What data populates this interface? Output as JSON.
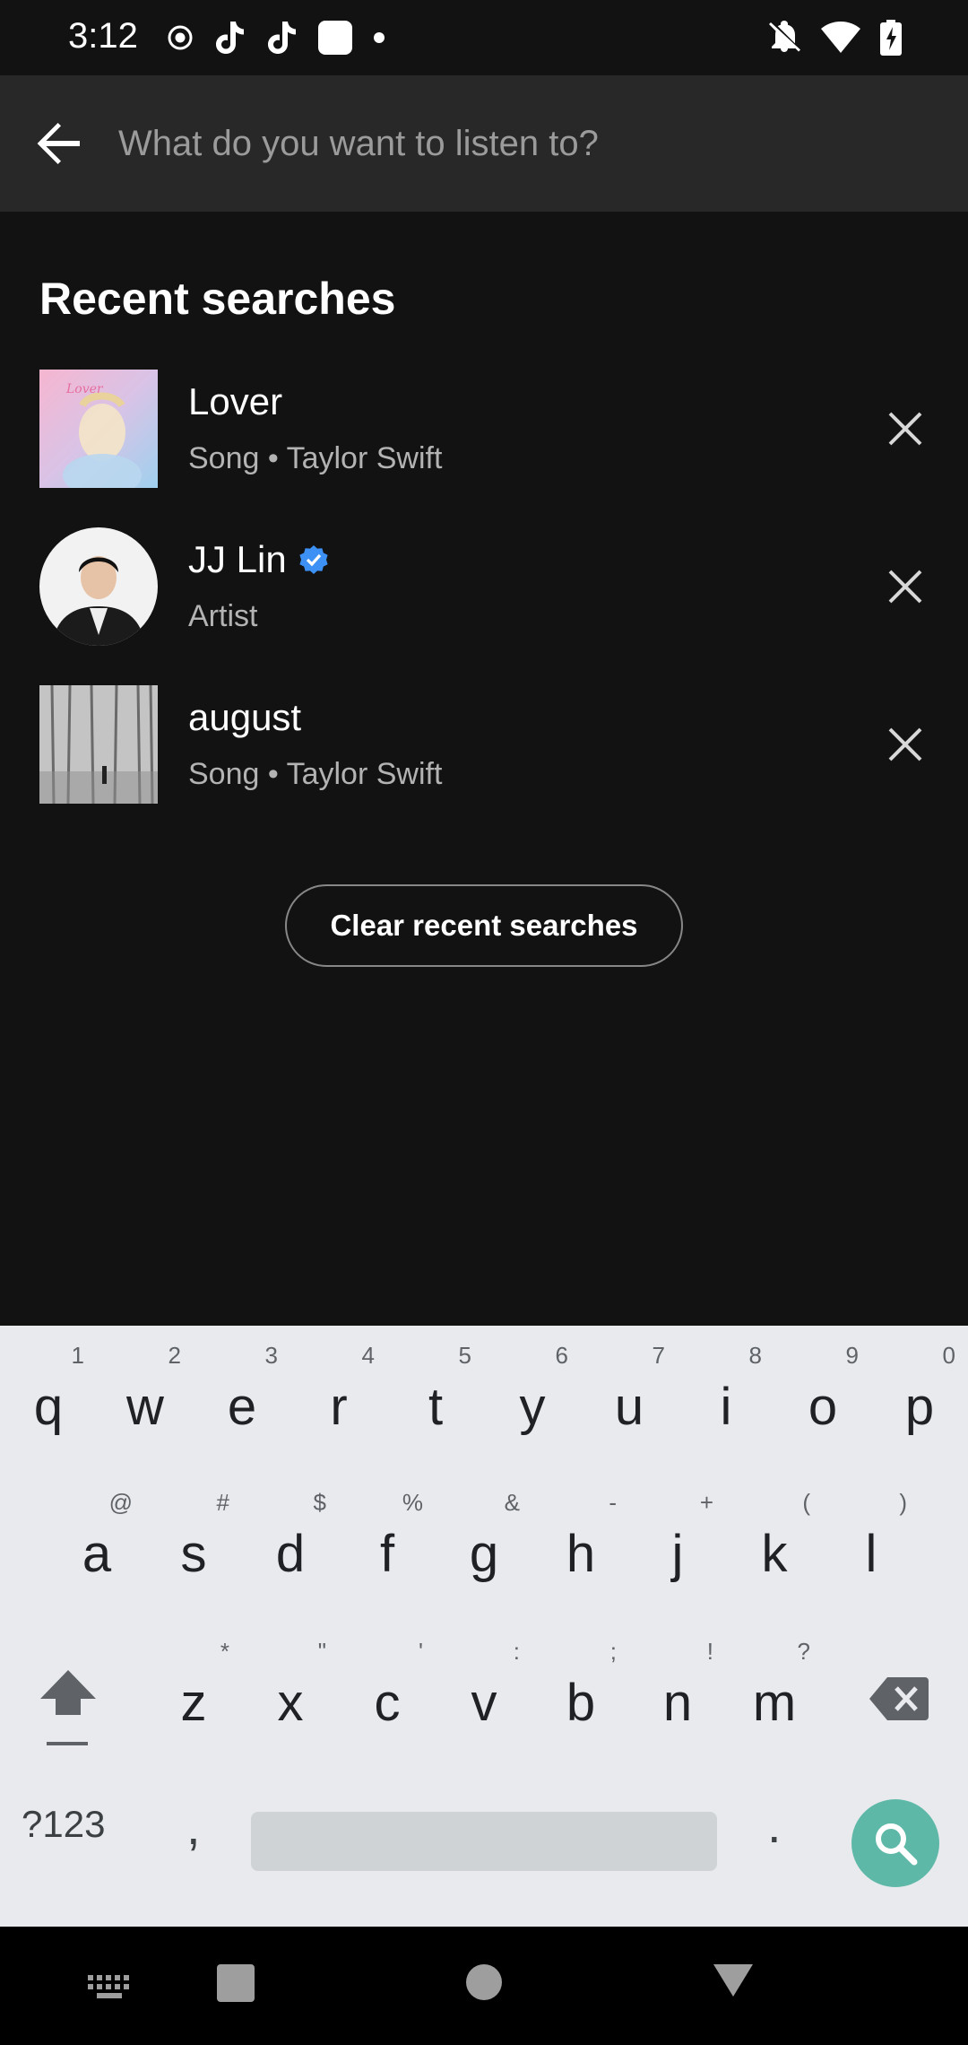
{
  "status_bar": {
    "time": "3:12",
    "left_icons": [
      "record-icon",
      "tiktok-icon",
      "tiktok-icon",
      "app-square-icon",
      "dot-icon"
    ],
    "right_icons": [
      "bell-off-icon",
      "wifi-icon",
      "battery-charging-icon"
    ]
  },
  "search": {
    "placeholder": "What do you want to listen to?",
    "value": ""
  },
  "recent": {
    "title": "Recent searches",
    "items": [
      {
        "title": "Lover",
        "subtitle": "Song • Taylor Swift",
        "verified": false,
        "shape": "square"
      },
      {
        "title": "JJ Lin",
        "subtitle": "Artist",
        "verified": true,
        "shape": "round"
      },
      {
        "title": "august",
        "subtitle": "Song • Taylor Swift",
        "verified": false,
        "shape": "square"
      }
    ],
    "clear_label": "Clear recent searches"
  },
  "keyboard": {
    "row1": [
      {
        "ch": "q",
        "hint": "1"
      },
      {
        "ch": "w",
        "hint": "2"
      },
      {
        "ch": "e",
        "hint": "3"
      },
      {
        "ch": "r",
        "hint": "4"
      },
      {
        "ch": "t",
        "hint": "5"
      },
      {
        "ch": "y",
        "hint": "6"
      },
      {
        "ch": "u",
        "hint": "7"
      },
      {
        "ch": "i",
        "hint": "8"
      },
      {
        "ch": "o",
        "hint": "9"
      },
      {
        "ch": "p",
        "hint": "0"
      }
    ],
    "row2": [
      {
        "ch": "a",
        "hint": "@"
      },
      {
        "ch": "s",
        "hint": "#"
      },
      {
        "ch": "d",
        "hint": "$"
      },
      {
        "ch": "f",
        "hint": "%"
      },
      {
        "ch": "g",
        "hint": "&"
      },
      {
        "ch": "h",
        "hint": "-"
      },
      {
        "ch": "j",
        "hint": "+"
      },
      {
        "ch": "k",
        "hint": "("
      },
      {
        "ch": "l",
        "hint": ")"
      }
    ],
    "row3": [
      {
        "ch": "z",
        "hint": "*"
      },
      {
        "ch": "x",
        "hint": "\""
      },
      {
        "ch": "c",
        "hint": "'"
      },
      {
        "ch": "v",
        "hint": ":"
      },
      {
        "ch": "b",
        "hint": ";"
      },
      {
        "ch": "n",
        "hint": "!"
      },
      {
        "ch": "m",
        "hint": "?"
      }
    ],
    "symbols_label": "?123",
    "comma": ",",
    "period": "."
  },
  "colors": {
    "background": "#121212",
    "header": "#282828",
    "keyboard": "#e8eaed",
    "search_key": "#5eb8a8",
    "verified": "#3d91f4"
  }
}
